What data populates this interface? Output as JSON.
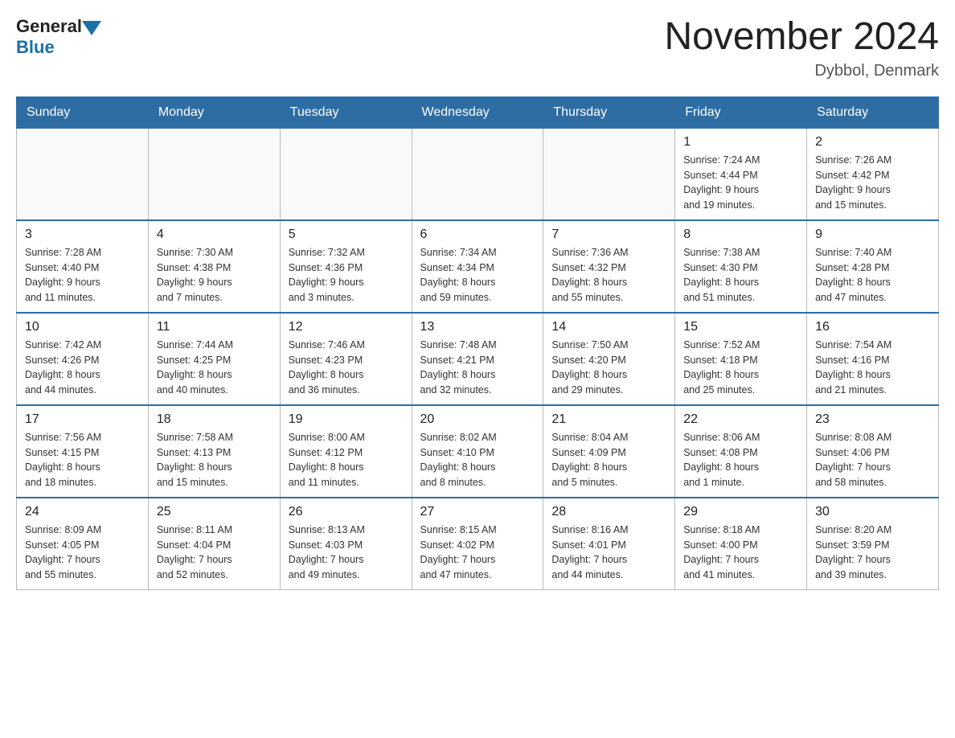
{
  "header": {
    "logo_general": "General",
    "logo_blue": "Blue",
    "title": "November 2024",
    "location": "Dybbol, Denmark"
  },
  "days_of_week": [
    "Sunday",
    "Monday",
    "Tuesday",
    "Wednesday",
    "Thursday",
    "Friday",
    "Saturday"
  ],
  "weeks": [
    [
      {
        "day": "",
        "info": ""
      },
      {
        "day": "",
        "info": ""
      },
      {
        "day": "",
        "info": ""
      },
      {
        "day": "",
        "info": ""
      },
      {
        "day": "",
        "info": ""
      },
      {
        "day": "1",
        "info": "Sunrise: 7:24 AM\nSunset: 4:44 PM\nDaylight: 9 hours\nand 19 minutes."
      },
      {
        "day": "2",
        "info": "Sunrise: 7:26 AM\nSunset: 4:42 PM\nDaylight: 9 hours\nand 15 minutes."
      }
    ],
    [
      {
        "day": "3",
        "info": "Sunrise: 7:28 AM\nSunset: 4:40 PM\nDaylight: 9 hours\nand 11 minutes."
      },
      {
        "day": "4",
        "info": "Sunrise: 7:30 AM\nSunset: 4:38 PM\nDaylight: 9 hours\nand 7 minutes."
      },
      {
        "day": "5",
        "info": "Sunrise: 7:32 AM\nSunset: 4:36 PM\nDaylight: 9 hours\nand 3 minutes."
      },
      {
        "day": "6",
        "info": "Sunrise: 7:34 AM\nSunset: 4:34 PM\nDaylight: 8 hours\nand 59 minutes."
      },
      {
        "day": "7",
        "info": "Sunrise: 7:36 AM\nSunset: 4:32 PM\nDaylight: 8 hours\nand 55 minutes."
      },
      {
        "day": "8",
        "info": "Sunrise: 7:38 AM\nSunset: 4:30 PM\nDaylight: 8 hours\nand 51 minutes."
      },
      {
        "day": "9",
        "info": "Sunrise: 7:40 AM\nSunset: 4:28 PM\nDaylight: 8 hours\nand 47 minutes."
      }
    ],
    [
      {
        "day": "10",
        "info": "Sunrise: 7:42 AM\nSunset: 4:26 PM\nDaylight: 8 hours\nand 44 minutes."
      },
      {
        "day": "11",
        "info": "Sunrise: 7:44 AM\nSunset: 4:25 PM\nDaylight: 8 hours\nand 40 minutes."
      },
      {
        "day": "12",
        "info": "Sunrise: 7:46 AM\nSunset: 4:23 PM\nDaylight: 8 hours\nand 36 minutes."
      },
      {
        "day": "13",
        "info": "Sunrise: 7:48 AM\nSunset: 4:21 PM\nDaylight: 8 hours\nand 32 minutes."
      },
      {
        "day": "14",
        "info": "Sunrise: 7:50 AM\nSunset: 4:20 PM\nDaylight: 8 hours\nand 29 minutes."
      },
      {
        "day": "15",
        "info": "Sunrise: 7:52 AM\nSunset: 4:18 PM\nDaylight: 8 hours\nand 25 minutes."
      },
      {
        "day": "16",
        "info": "Sunrise: 7:54 AM\nSunset: 4:16 PM\nDaylight: 8 hours\nand 21 minutes."
      }
    ],
    [
      {
        "day": "17",
        "info": "Sunrise: 7:56 AM\nSunset: 4:15 PM\nDaylight: 8 hours\nand 18 minutes."
      },
      {
        "day": "18",
        "info": "Sunrise: 7:58 AM\nSunset: 4:13 PM\nDaylight: 8 hours\nand 15 minutes."
      },
      {
        "day": "19",
        "info": "Sunrise: 8:00 AM\nSunset: 4:12 PM\nDaylight: 8 hours\nand 11 minutes."
      },
      {
        "day": "20",
        "info": "Sunrise: 8:02 AM\nSunset: 4:10 PM\nDaylight: 8 hours\nand 8 minutes."
      },
      {
        "day": "21",
        "info": "Sunrise: 8:04 AM\nSunset: 4:09 PM\nDaylight: 8 hours\nand 5 minutes."
      },
      {
        "day": "22",
        "info": "Sunrise: 8:06 AM\nSunset: 4:08 PM\nDaylight: 8 hours\nand 1 minute."
      },
      {
        "day": "23",
        "info": "Sunrise: 8:08 AM\nSunset: 4:06 PM\nDaylight: 7 hours\nand 58 minutes."
      }
    ],
    [
      {
        "day": "24",
        "info": "Sunrise: 8:09 AM\nSunset: 4:05 PM\nDaylight: 7 hours\nand 55 minutes."
      },
      {
        "day": "25",
        "info": "Sunrise: 8:11 AM\nSunset: 4:04 PM\nDaylight: 7 hours\nand 52 minutes."
      },
      {
        "day": "26",
        "info": "Sunrise: 8:13 AM\nSunset: 4:03 PM\nDaylight: 7 hours\nand 49 minutes."
      },
      {
        "day": "27",
        "info": "Sunrise: 8:15 AM\nSunset: 4:02 PM\nDaylight: 7 hours\nand 47 minutes."
      },
      {
        "day": "28",
        "info": "Sunrise: 8:16 AM\nSunset: 4:01 PM\nDaylight: 7 hours\nand 44 minutes."
      },
      {
        "day": "29",
        "info": "Sunrise: 8:18 AM\nSunset: 4:00 PM\nDaylight: 7 hours\nand 41 minutes."
      },
      {
        "day": "30",
        "info": "Sunrise: 8:20 AM\nSunset: 3:59 PM\nDaylight: 7 hours\nand 39 minutes."
      }
    ]
  ]
}
